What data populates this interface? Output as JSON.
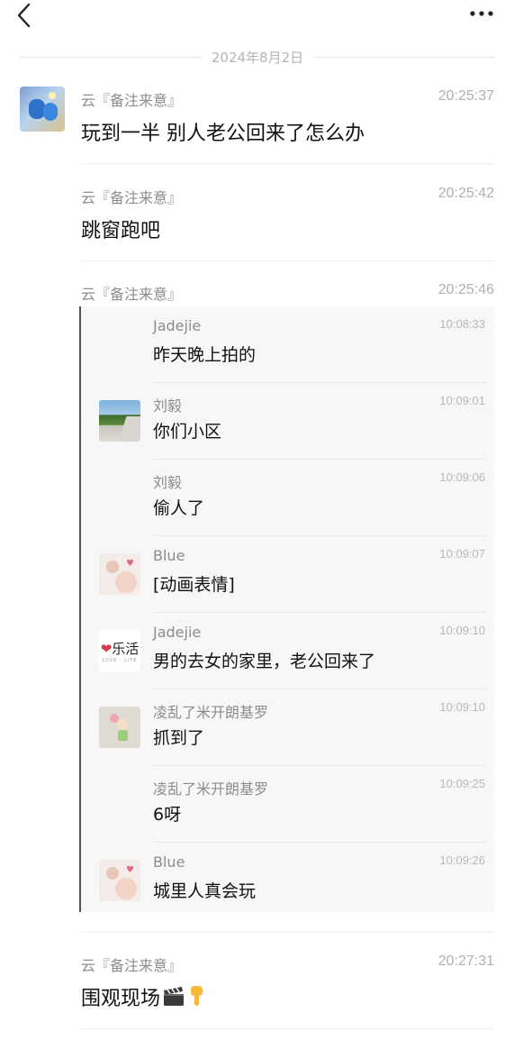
{
  "header": {
    "back_icon": "chevron-left-icon",
    "more_icon": "more-horizontal-icon"
  },
  "date_divider": "2024年8月2日",
  "messages": [
    {
      "sender": "云『备注来意』",
      "time": "20:25:37",
      "text": "玩到一半 别人老公回来了怎么办"
    },
    {
      "sender": "云『备注来意』",
      "time": "20:25:42",
      "text": "跳窗跑吧"
    },
    {
      "sender": "云『备注来意』",
      "time": "20:25:46"
    },
    {
      "sender": "云『备注来意』",
      "time": "20:27:31",
      "text": "围观现场",
      "emojis": [
        "clapperboard-icon",
        "pointing-down-icon"
      ]
    }
  ],
  "forwarded": [
    {
      "name": "Jadejie",
      "time": "10:08:33",
      "text": "昨天晚上拍的"
    },
    {
      "name": "刘毅",
      "time": "10:09:01",
      "text": "你们小区",
      "avatar": "road-photo"
    },
    {
      "name": "刘毅",
      "time": "10:09:06",
      "text": "偷人了"
    },
    {
      "name": "Blue",
      "time": "10:09:07",
      "text": "[动画表情]",
      "avatar": "couple-illustration"
    },
    {
      "name": "Jadejie",
      "time": "10:09:10",
      "text": "男的去女的家里，老公回来了",
      "avatar": "lehuo-logo",
      "avatar_text": "乐活"
    },
    {
      "name": "凌乱了米开朗基罗",
      "time": "10:09:10",
      "text": "抓到了",
      "avatar": "girl-balloon-illustration"
    },
    {
      "name": "凌乱了米开朗基罗",
      "time": "10:09:25",
      "text": "6呀"
    },
    {
      "name": "Blue",
      "time": "10:09:26",
      "text": "城里人真会玩",
      "avatar": "couple-illustration"
    }
  ],
  "colors": {
    "meta_gray": "#8c8c8c",
    "time_gray": "#b0b0b0",
    "panel_bg": "#f7f7f7",
    "quote_bar": "#555555"
  }
}
